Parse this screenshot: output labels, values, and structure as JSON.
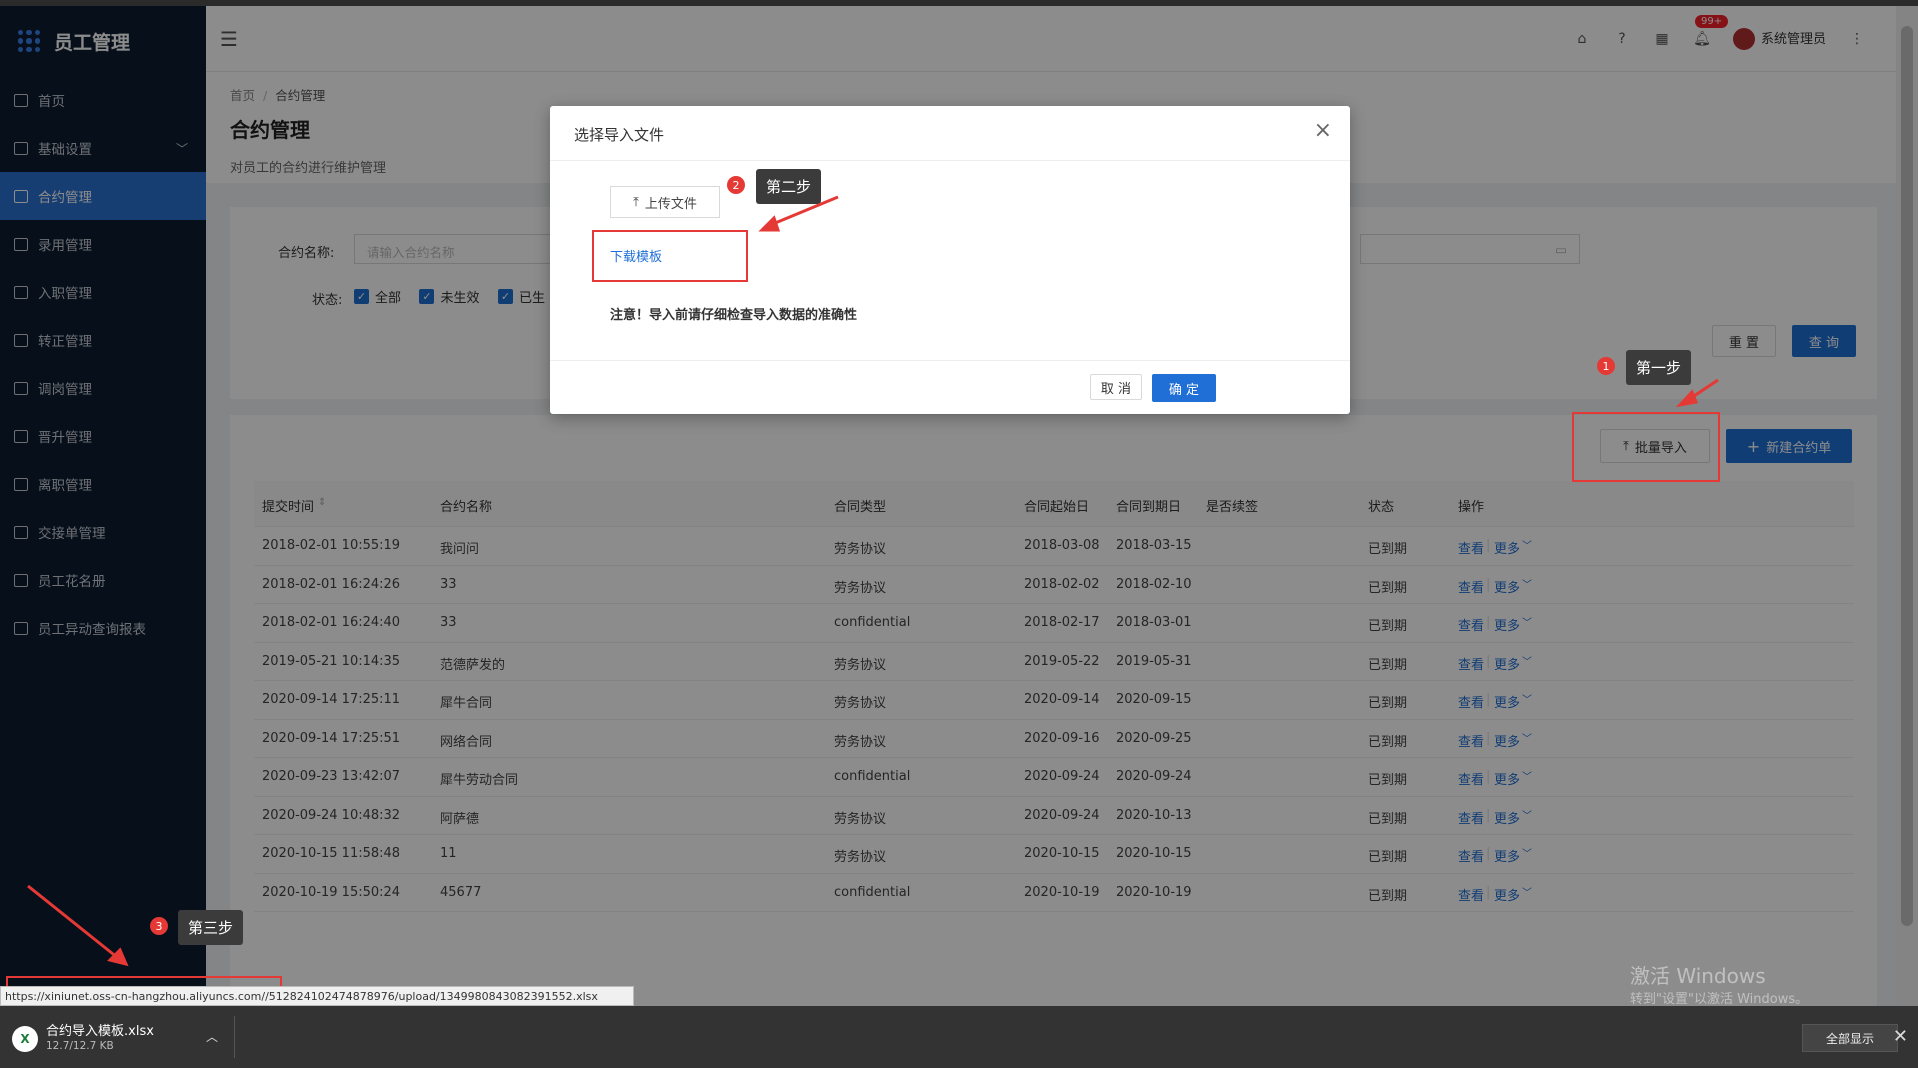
{
  "app": {
    "title": "员工管理"
  },
  "sidebar": {
    "items": [
      {
        "label": "首页"
      },
      {
        "label": "基础设置",
        "has_caret": true
      },
      {
        "label": "合约管理",
        "active": true
      },
      {
        "label": "录用管理"
      },
      {
        "label": "入职管理"
      },
      {
        "label": "转正管理"
      },
      {
        "label": "调岗管理"
      },
      {
        "label": "晋升管理"
      },
      {
        "label": "离职管理"
      },
      {
        "label": "交接单管理"
      },
      {
        "label": "员工花名册"
      },
      {
        "label": "员工异动查询报表"
      }
    ]
  },
  "header": {
    "notification_badge": "99+",
    "user_name": "系统管理员"
  },
  "page": {
    "breadcrumb": [
      "首页",
      "合约管理"
    ],
    "title": "合约管理",
    "description": "对员工的合约进行维护管理"
  },
  "filter": {
    "name_label": "合约名称:",
    "name_placeholder": "请输入合约名称",
    "status_label": "状态:",
    "status_options": [
      "全部",
      "未生效",
      "已生"
    ],
    "reset_label": "重 置",
    "query_label": "查 询"
  },
  "toolbar": {
    "import_label": "批量导入",
    "new_label": "新建合约单"
  },
  "table": {
    "columns": [
      "提交时间",
      "合约名称",
      "合同类型",
      "合同起始日",
      "合同到期日",
      "是否续签",
      "状态",
      "操作"
    ],
    "view_label": "查看",
    "more_label": "更多",
    "rows": [
      [
        "2018-02-01 10:55:19",
        "我问问",
        "劳务协议",
        "2018-03-08",
        "2018-03-15",
        "",
        "已到期"
      ],
      [
        "2018-02-01 16:24:26",
        "33",
        "劳务协议",
        "2018-02-02",
        "2018-02-10",
        "",
        "已到期"
      ],
      [
        "2018-02-01 16:24:40",
        "33",
        "confidential",
        "2018-02-17",
        "2018-03-01",
        "",
        "已到期"
      ],
      [
        "2019-05-21 10:14:35",
        "范德萨发的",
        "劳务协议",
        "2019-05-22",
        "2019-05-31",
        "",
        "已到期"
      ],
      [
        "2020-09-14 17:25:11",
        "犀牛合同",
        "劳务协议",
        "2020-09-14",
        "2020-09-15",
        "",
        "已到期"
      ],
      [
        "2020-09-14 17:25:51",
        "网络合同",
        "劳务协议",
        "2020-09-16",
        "2020-09-25",
        "",
        "已到期"
      ],
      [
        "2020-09-23 13:42:07",
        "犀牛劳动合同",
        "confidential",
        "2020-09-24",
        "2020-09-24",
        "",
        "已到期"
      ],
      [
        "2020-09-24 10:48:32",
        "阿萨德",
        "劳务协议",
        "2020-09-24",
        "2020-10-13",
        "",
        "已到期"
      ],
      [
        "2020-10-15 11:58:48",
        "11",
        "劳务协议",
        "2020-10-15",
        "2020-10-15",
        "",
        "已到期"
      ],
      [
        "2020-10-19 15:50:24",
        "45677",
        "confidential",
        "2020-10-19",
        "2020-10-19",
        "",
        "已到期"
      ]
    ]
  },
  "modal": {
    "title": "选择导入文件",
    "upload_label": "上传文件",
    "download_template_label": "下载模板",
    "notice": "注意！导入前请仔细检查导入数据的准确性",
    "cancel_label": "取 消",
    "confirm_label": "确 定"
  },
  "annotations": {
    "step1": {
      "num": "1",
      "text": "第一步"
    },
    "step2": {
      "num": "2",
      "text": "第二步"
    },
    "step3": {
      "num": "3",
      "text": "第三步"
    }
  },
  "download_bar": {
    "url": "https://xiniunet.oss-cn-hangzhou.aliyuncs.com//512824102474878976/upload/1349980843082391552.xlsx",
    "file_name": "合约导入模板.xlsx",
    "file_size": "12.7/12.7 KB",
    "show_all_label": "全部显示"
  },
  "watermark": {
    "line1": "激活 Windows",
    "line2": "转到\"设置\"以激活 Windows。"
  }
}
